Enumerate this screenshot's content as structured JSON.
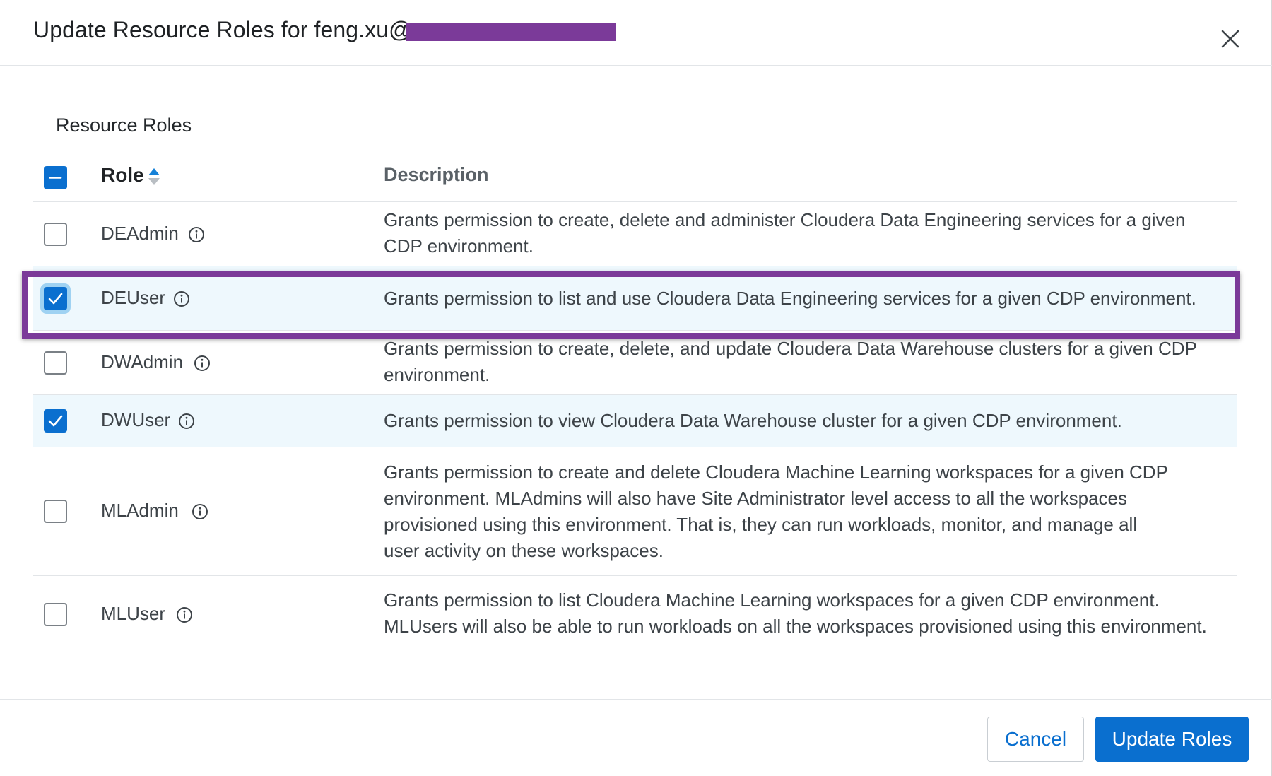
{
  "dialog": {
    "title": "Update Resource Roles for feng.xu@",
    "section_title": "Resource Roles"
  },
  "table": {
    "headers": {
      "role": "Role",
      "description": "Description"
    },
    "rows": [
      {
        "role": "DEAdmin",
        "checked": false,
        "description": "Grants permission to create, delete and administer Cloudera Data Engineering services for a given CDP environment."
      },
      {
        "role": "DEUser",
        "checked": true,
        "description": "Grants permission to list and use Cloudera Data Engineering services for a given CDP environment."
      },
      {
        "role": "DWAdmin",
        "checked": false,
        "description": "Grants permission to create, delete, and update Cloudera Data Warehouse clusters for a given CDP environment."
      },
      {
        "role": "DWUser",
        "checked": true,
        "description": "Grants permission to view Cloudera Data Warehouse cluster for a given CDP environment."
      },
      {
        "role": "MLAdmin",
        "checked": false,
        "description": "Grants permission to create and delete Cloudera Machine Learning workspaces for a given CDP environment. MLAdmins will also have Site Administrator level access to all the workspaces provisioned using this environment. That is, they can run workloads, monitor, and manage all user activity on these workspaces."
      },
      {
        "role": "MLUser",
        "checked": false,
        "description": "Grants permission to list Cloudera Machine Learning workspaces for a given CDP environment. MLUsers will also be able to run workloads on all the workspaces provisioned using this environment."
      }
    ]
  },
  "footer": {
    "cancel_label": "Cancel",
    "submit_label": "Update Roles"
  },
  "colors": {
    "primary": "#0a6fcf",
    "selected_row": "#eef8fd",
    "annotation": "#7b3a99"
  },
  "icons": [
    "close-icon",
    "sort-icon",
    "info-icon",
    "checkmark-icon",
    "indeterminate-icon"
  ]
}
